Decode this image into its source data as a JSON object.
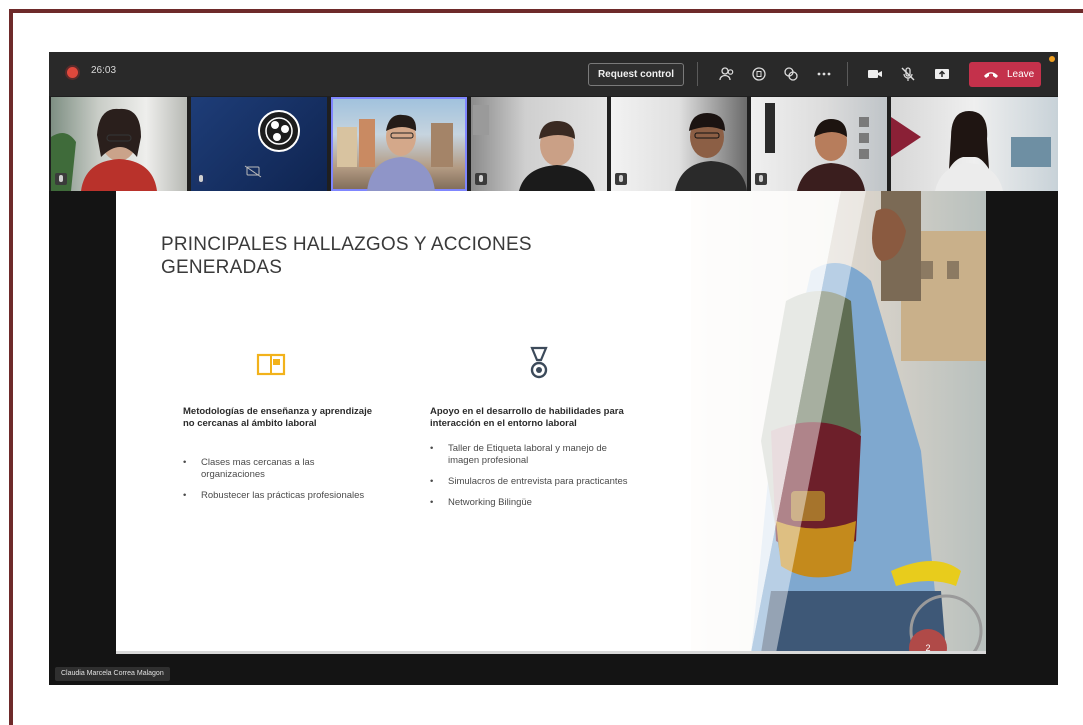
{
  "toolbar": {
    "timer": "26:03",
    "request_control": "Request control",
    "leave": "Leave",
    "icons": [
      "people-icon",
      "chat-icon",
      "reactions-icon",
      "more-icon",
      "camera-icon",
      "mic-off-icon",
      "share-icon"
    ]
  },
  "slide": {
    "title": "PRINCIPALES HALLAZGOS Y ACCIONES GENERADAS",
    "left_column": {
      "heading": "Metodologías de enseñanza y aprendizaje no cercanas al ámbito laboral",
      "bullets": [
        "Clases mas cercanas a las organizaciones",
        "Robustecer las prácticas profesionales"
      ]
    },
    "right_column": {
      "heading": "Apoyo en el desarrollo de habilidades para interacción en el entorno laboral",
      "bullets": [
        "Taller de Etiqueta laboral y manejo de imagen profesional",
        "Simulacros de entrevista para practicantes",
        "Networking Bilingüe"
      ]
    },
    "page_number": "2"
  },
  "speaker": {
    "name": "Claudia Marcela Correa Malagon"
  },
  "colors": {
    "leave": "#c4314b",
    "accent_frame": "#6e2a2a",
    "book_icon": "#f2b21b",
    "page_badge": "#b04a48"
  }
}
